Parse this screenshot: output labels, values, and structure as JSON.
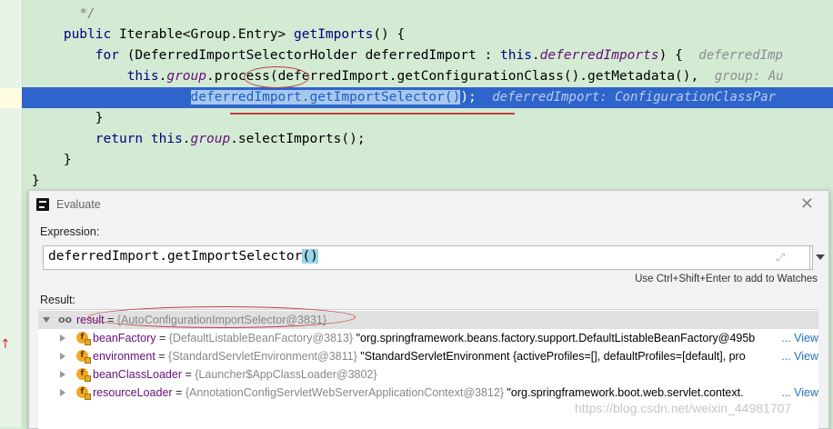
{
  "code_lines": [
    {
      "indent": "          ",
      "comment": "*/"
    },
    {
      "indent": "        ",
      "kw1": "public ",
      "text1": "Iterable<Group.Entry> ",
      "method": "getImports",
      "text2": "() {"
    },
    {
      "indent": "            ",
      "kw1": "for ",
      "text1": "(DeferredImportSelectorHolder deferredImport : ",
      "kw2": "this",
      "text2": ".",
      "field": "deferredImports",
      "text3": ") {  ",
      "hint": "deferredImp"
    },
    {
      "indent": "                ",
      "kw1": "this",
      "text1": ".",
      "field": "group",
      "text2": ".",
      "call": "process",
      "text3": "(deferredImport.getConfigurationClass().getMetadata(),  ",
      "hint": "group: Au"
    },
    {
      "indent": "                        ",
      "sel": "deferredImport.getImportSelector()",
      "tail": ");  ",
      "hint": "deferredImport: ConfigurationClassPar"
    },
    {
      "indent": "            ",
      "text1": "}"
    },
    {
      "indent": "            ",
      "kw1": "return ",
      "kw2": "this",
      "text2": ".",
      "field": "group",
      "text3": ".selectImports();"
    },
    {
      "indent": "        ",
      "text1": "}"
    },
    {
      "indent": "    ",
      "text1": "}"
    }
  ],
  "dialog": {
    "title": "Evaluate",
    "close": "✕",
    "expression_label": "Expression:",
    "expression_before": "deferredImport.getImportSelector",
    "expression_paren": "()",
    "expand_glyph": "⤢",
    "watches_hint": "Use Ctrl+Shift+Enter to add to Watches",
    "result_label": "Result:",
    "result_row": {
      "icon": "oo",
      "name": "result",
      "eq": " = ",
      "type": "{AutoConfigurationImportSelector@3831}"
    },
    "fields": [
      {
        "name": "beanFactory",
        "type": "{DefaultListableBeanFactory@3813}",
        "value": " \"org.springframework.beans.factory.support.DefaultListableBeanFactory@495b",
        "link": "... View"
      },
      {
        "name": "environment",
        "type": "{StandardServletEnvironment@3811}",
        "value": " \"StandardServletEnvironment {activeProfiles=[], defaultProfiles=[default], pro",
        "link": "... View"
      },
      {
        "name": "beanClassLoader",
        "type": "{Launcher$AppClassLoader@3802}",
        "value": "",
        "link": ""
      },
      {
        "name": "resourceLoader",
        "type": "{AnnotationConfigServletWebServerApplicationContext@3812}",
        "value": " \"org.springframework.boot.web.servlet.context.",
        "link": "... View"
      }
    ],
    "field_icon_letter": "f"
  },
  "watermark": "https://blog.csdn.net/weixin_44981707",
  "gutter_marker": "↑",
  "colors": {
    "selection": "#2f65ca",
    "editor_bg": "#d3ead3",
    "annotation": "#c04040",
    "link": "#2470c2"
  }
}
